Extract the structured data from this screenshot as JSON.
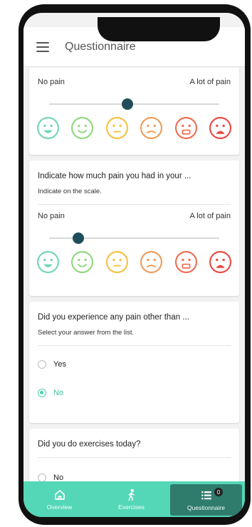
{
  "appbar": {
    "title": "Questionnaire",
    "menu_icon": "hamburger-menu-icon"
  },
  "pain_scale": {
    "min_label": "No pain",
    "max_label": "A lot of pain",
    "faces": [
      {
        "name": "face-laughing-icon",
        "color": "#6fd6b5"
      },
      {
        "name": "face-smiling-icon",
        "color": "#8fd77a"
      },
      {
        "name": "face-neutral-icon",
        "color": "#f2c13d"
      },
      {
        "name": "face-worried-icon",
        "color": "#f29a55"
      },
      {
        "name": "face-grimacing-icon",
        "color": "#ee6a4f"
      },
      {
        "name": "face-crying-icon",
        "color": "#e9473f"
      }
    ]
  },
  "questions": {
    "q1": {
      "slider_value": 0.46
    },
    "q2": {
      "title": "Indicate how much pain you had in your ...",
      "subtitle": "Indicate on the scale.",
      "slider_value": 0.17
    },
    "q3": {
      "title": "Did you experience any pain other than ...",
      "subtitle": "Select your answer from the list.",
      "options": [
        {
          "label": "Yes",
          "checked": false
        },
        {
          "label": "No",
          "checked": true
        }
      ]
    },
    "q4": {
      "title": "Did you do exercises today?",
      "options": [
        {
          "label": "No",
          "checked": false
        }
      ]
    }
  },
  "bottom_nav": {
    "items": [
      {
        "label": "Overview",
        "icon": "home-icon",
        "active": false
      },
      {
        "label": "Exercises",
        "icon": "walking-person-icon",
        "active": false
      },
      {
        "label": "Questionnaire",
        "icon": "list-icon",
        "active": true,
        "badge": "0"
      }
    ]
  },
  "colors": {
    "accent": "#54d7b7",
    "active_tab": "#2f7c6c",
    "slider_thumb": "#1f4e5a"
  }
}
